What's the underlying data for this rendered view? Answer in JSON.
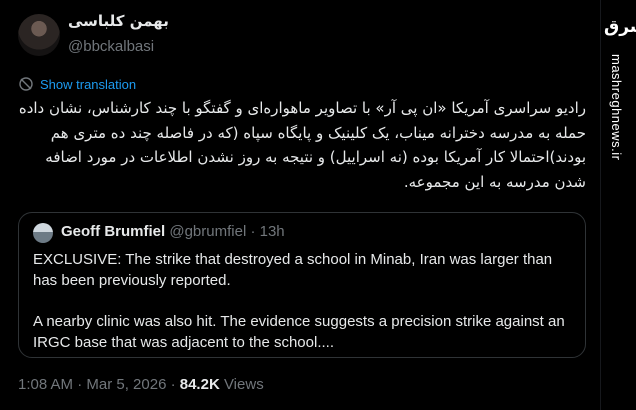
{
  "tweet": {
    "author_name": "بهمن کلباسی",
    "author_handle": "@bbckalbasi",
    "show_translation": "Show translation",
    "text": "رادیو سراسری آمریکا «ان پی آر» با تصاویر ماهواره‌ای و گفتگو با چند کارشناس، نشان داده حمله به مدرسه دخترانه میناب، یک کلینیک و پایگاه سپاه (که در فاصله چند ده متری هم بودند)احتمالا کار آمریکا بوده (نه اسراییل) و نتیجه به روز نشدن اطلاعات در مورد اضافه شدن مدرسه به این مجموعه.",
    "quote": {
      "name": "Geoff Brumfiel",
      "handle": "@gbrumfiel",
      "separator": "·",
      "time": "13h",
      "paragraph1": "EXCLUSIVE: The strike that destroyed a school in Minab, Iran was larger than has been previously reported.",
      "paragraph2": "A nearby clinic was also hit.  The evidence suggests a precision strike against an IRGC base that was adjacent to the school...."
    },
    "timestamp": "1:08 AM · Mar 5, 2026 · ",
    "views_count": "84.2K",
    "views_label": " Views"
  },
  "sidebar": {
    "logo_text": "مشرق",
    "site_url": "mashreghnews.ir"
  },
  "colors": {
    "background": "#000000",
    "text": "#e7e9ea",
    "muted": "#71767b",
    "link": "#1d9bf0",
    "border": "#2f3336"
  },
  "icons": {
    "avatar": "profile-photo",
    "translate": "globe-icon",
    "quote_avatar": "profile-photo"
  }
}
